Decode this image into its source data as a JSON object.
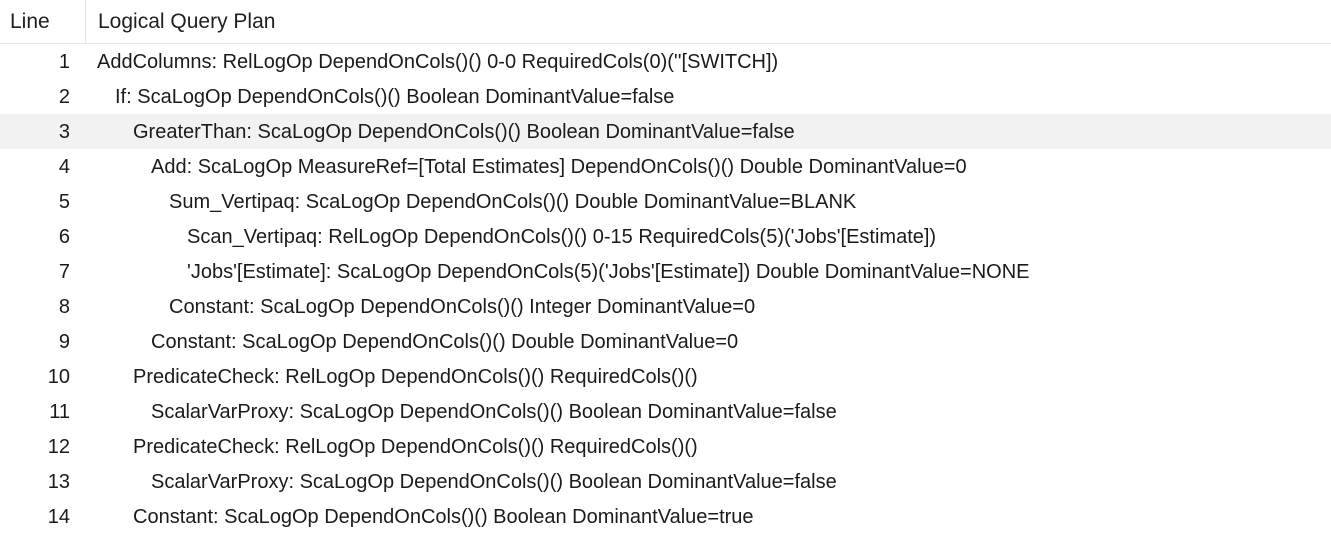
{
  "grid": {
    "columns": [
      {
        "id": "line",
        "label": "Line"
      },
      {
        "id": "plan",
        "label": "Logical Query Plan"
      }
    ],
    "selected_row_index": 2,
    "colors": {
      "background": "#ffffff",
      "text": "#1b1b1b",
      "header_text": "#1f1f1f",
      "selected_row": "#f2f2f2",
      "header_border": "#e6e6e6",
      "column_divider": "#e2e2e2"
    },
    "rows": [
      {
        "line": "1",
        "indent": 0,
        "text": "AddColumns: RelLogOp DependOnCols()() 0-0 RequiredCols(0)(''[SWITCH])"
      },
      {
        "line": "2",
        "indent": 1,
        "text": "If: ScaLogOp DependOnCols()() Boolean DominantValue=false"
      },
      {
        "line": "3",
        "indent": 2,
        "text": "GreaterThan: ScaLogOp DependOnCols()() Boolean DominantValue=false"
      },
      {
        "line": "4",
        "indent": 3,
        "text": "Add: ScaLogOp MeasureRef=[Total Estimates] DependOnCols()() Double DominantValue=0"
      },
      {
        "line": "5",
        "indent": 4,
        "text": "Sum_Vertipaq: ScaLogOp DependOnCols()() Double DominantValue=BLANK"
      },
      {
        "line": "6",
        "indent": 5,
        "text": "Scan_Vertipaq: RelLogOp DependOnCols()() 0-15 RequiredCols(5)('Jobs'[Estimate])"
      },
      {
        "line": "7",
        "indent": 5,
        "text": "'Jobs'[Estimate]: ScaLogOp DependOnCols(5)('Jobs'[Estimate]) Double DominantValue=NONE"
      },
      {
        "line": "8",
        "indent": 4,
        "text": "Constant: ScaLogOp DependOnCols()() Integer DominantValue=0"
      },
      {
        "line": "9",
        "indent": 3,
        "text": "Constant: ScaLogOp DependOnCols()() Double DominantValue=0"
      },
      {
        "line": "10",
        "indent": 2,
        "text": "PredicateCheck: RelLogOp DependOnCols()() RequiredCols()()"
      },
      {
        "line": "11",
        "indent": 3,
        "text": "ScalarVarProxy: ScaLogOp DependOnCols()() Boolean DominantValue=false"
      },
      {
        "line": "12",
        "indent": 2,
        "text": "PredicateCheck: RelLogOp DependOnCols()() RequiredCols()()"
      },
      {
        "line": "13",
        "indent": 3,
        "text": "ScalarVarProxy: ScaLogOp DependOnCols()() Boolean DominantValue=false"
      },
      {
        "line": "14",
        "indent": 2,
        "text": "Constant: ScaLogOp DependOnCols()() Boolean DominantValue=true"
      }
    ]
  }
}
